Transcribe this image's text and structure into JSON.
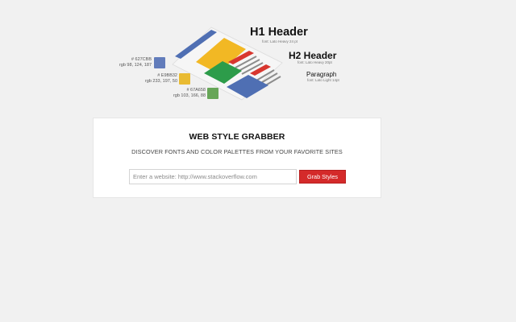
{
  "illustration": {
    "h1": {
      "label": "H1 Header",
      "font": "font: Lato Heavy 24 pt"
    },
    "h2": {
      "label": "H2 Header",
      "font": "font: Lato Heavy 20pt"
    },
    "paragraph": {
      "label": "Paragraph",
      "font": "font: Lato Light 14pt"
    },
    "swatches": [
      {
        "hex": "# 627CBB",
        "rgb": "rgb 98, 124, 187",
        "color": "#627CBB"
      },
      {
        "hex": "# E9BB32",
        "rgb": "rgb 233, 197, 50",
        "color": "#E9BB32"
      },
      {
        "hex": "# 67A658",
        "rgb": "rgb 103, 166, 88",
        "color": "#67A658"
      }
    ],
    "colors": {
      "blue": "#4f6fb3",
      "yellow": "#f2b824",
      "green": "#2d9c4a",
      "red": "#d8362f",
      "gray": "#8c8c8c",
      "page": "#f6f6f6"
    }
  },
  "card": {
    "title": "WEB STYLE GRABBER",
    "subtitle": "DISCOVER FONTS AND COLOR PALETTES FROM YOUR FAVORITE SITES",
    "input_placeholder": "Enter a website: http://www.stackoverflow.com",
    "input_value": "",
    "button_label": "Grab Styles"
  }
}
